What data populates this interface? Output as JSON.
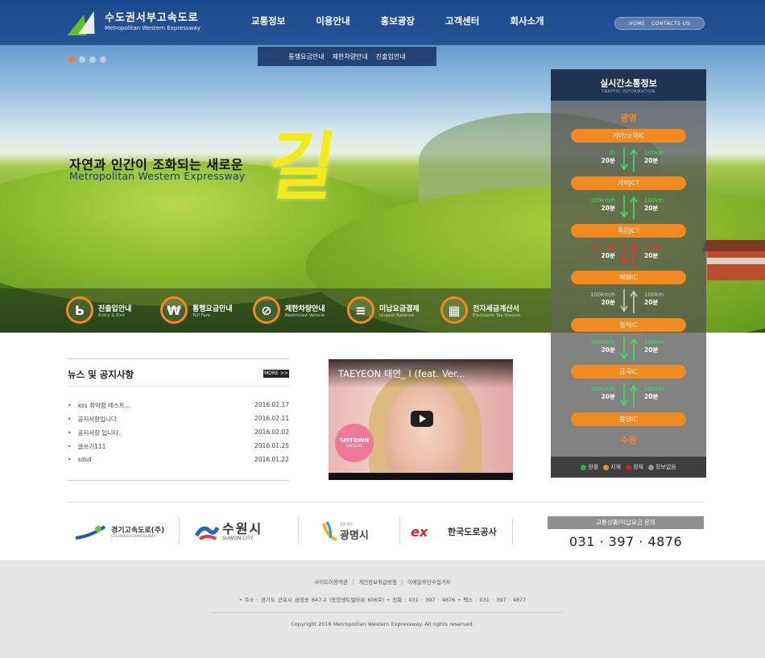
{
  "header": {
    "logo_ko": "수도권서부고속도로",
    "logo_en": "Metropolitan Western Expressway",
    "nav": [
      "교통정보",
      "이용안내",
      "홍보광장",
      "고객센터",
      "회사소개"
    ],
    "toplinks": [
      "HOME",
      "CONTACTS US"
    ],
    "subnav": [
      "통행요금안내",
      "제한차량안내",
      "진출입안내"
    ]
  },
  "hero": {
    "headline": "자연과 인간이 조화되는 새로운",
    "headline_en": "Metropolitan Western Expressway",
    "big_char": "길",
    "slider_dots": 4,
    "active_dot": 0
  },
  "quick_links": [
    {
      "title": "진출입안내",
      "sub": "Entry & Exit",
      "icon": "entry-exit-icon",
      "glyph": "Ь"
    },
    {
      "title": "통행요금안내",
      "sub": "Toll Fare",
      "icon": "won-icon",
      "glyph": "₩"
    },
    {
      "title": "제한차량안내",
      "sub": "Restricted Vehicle",
      "icon": "restricted-vehicle-icon",
      "glyph": "⊘"
    },
    {
      "title": "미납요금결제",
      "sub": "Unpaid Balance",
      "icon": "coins-icon",
      "glyph": "≡"
    },
    {
      "title": "전자세금계산서",
      "sub": "Electronic Tax Invoice",
      "icon": "calculator-icon",
      "glyph": "▦"
    }
  ],
  "traffic": {
    "title": "실시간소통정보",
    "subtitle": "TRAFFIC INFORMATION",
    "city_top": "광명",
    "city_bottom": "수원",
    "interchanges": [
      "기아/소하IC",
      "가학JCT",
      "목감JCT",
      "매화IC",
      "일직IC",
      "금곡IC",
      "봉담IC"
    ],
    "segments": [
      {
        "left_speed": "/h",
        "left_time": "20분",
        "right_speed": "100km",
        "right_time": "20분",
        "left_status": "green",
        "right_status": "green"
      },
      {
        "left_speed": "100km/h",
        "left_time": "20분",
        "right_speed": "100km",
        "right_time": "20분",
        "left_status": "green",
        "right_status": "green"
      },
      {
        "left_speed": "100km/h",
        "left_time": "20분",
        "right_speed": "100km",
        "right_time": "20분",
        "left_status": "red",
        "right_status": "red"
      },
      {
        "left_speed": "100km/h",
        "left_time": "20분",
        "right_speed": "100km",
        "right_time": "20분",
        "left_status": "gray",
        "right_status": "gray"
      },
      {
        "left_speed": "100km/h",
        "left_time": "20분",
        "right_speed": "100km",
        "right_time": "20분",
        "left_status": "green",
        "right_status": "green"
      },
      {
        "left_speed": "100km/h",
        "left_time": "20분",
        "right_speed": "100km",
        "right_time": "20분",
        "left_status": "green",
        "right_status": "green"
      }
    ],
    "legend": [
      {
        "label": "원활",
        "color": "#2bb24c"
      },
      {
        "label": "지체",
        "color": "#f18a20"
      },
      {
        "label": "정체",
        "color": "#d42020"
      },
      {
        "label": "정보없음",
        "color": "#9a9a9a"
      }
    ],
    "status_colors": {
      "green": "#3ee05a",
      "red": "#ff2a2a",
      "gray": "#cccccc"
    }
  },
  "news": {
    "title": "뉴스 및 공지사항",
    "more": "MORE >>",
    "items": [
      {
        "title": "xss 취약점 테스트...",
        "date": "2016.02.17"
      },
      {
        "title": "공지사항입니다.",
        "date": "2016.02.11"
      },
      {
        "title": "공지사항 입니다.",
        "date": "2016.02.02"
      },
      {
        "title": "글쓰기111",
        "date": "2016.01.25"
      },
      {
        "title": "sdsd",
        "date": "2016.01.22"
      }
    ]
  },
  "video": {
    "title": "TAEYEON 태연_ I (feat. Ver...",
    "badge": "SMTOWN",
    "badge_sub": "OFFICIAL"
  },
  "partners": [
    {
      "name": "경기고속도로(주)",
      "sub": "GYEONGGI EXPRESSWAY"
    },
    {
      "name": "수원시",
      "sub": "SUWON CITY"
    },
    {
      "name": "광명시",
      "sub": "빛을 품은"
    },
    {
      "name": "한국도로공사",
      "sub": ""
    }
  ],
  "contact": {
    "label": "교통상황/미납요금 문의",
    "phone": "031 · 397 · 4876"
  },
  "footer": {
    "links": [
      "사이트이용약관",
      "개인정보취급방침",
      "이메일무단수집거부"
    ],
    "address": "•  주소 : 경기도 군포시 금정동 847-2 (동양센트럴타워 606호)    •  전화 : 031 · 397 · 4876    •  팩스 : 031 · 397 · 4877",
    "copyright": "Copyright 2016 Metropolitan Western Expressway. All rights reserved."
  },
  "colors": {
    "accent": "#f18a20",
    "nav_bg": "#1f3c7a",
    "panel_head": "#1f3553"
  }
}
